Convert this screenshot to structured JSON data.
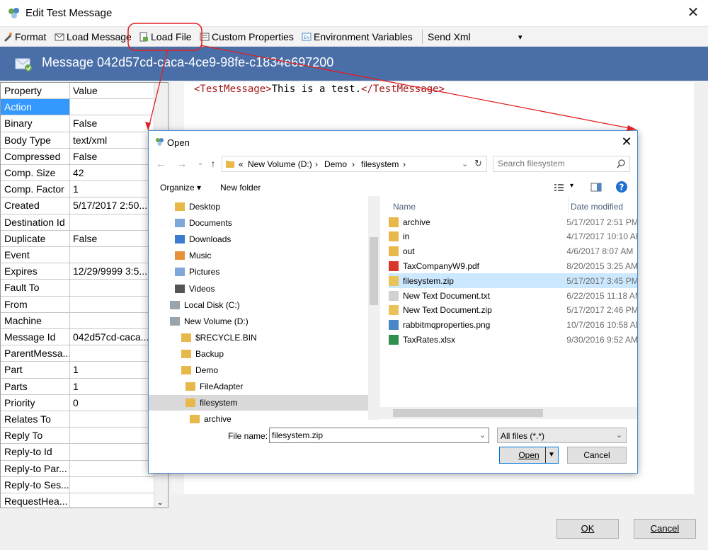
{
  "window": {
    "title": "Edit Test Message",
    "close": "✕"
  },
  "toolbar": {
    "format": "Format",
    "load_message": "Load Message",
    "load_file": "Load File",
    "custom_properties": "Custom Properties",
    "environment_variables": "Environment Variables",
    "send_xml": "Send Xml",
    "dropdown": "▾"
  },
  "header": {
    "title": "Message 042d57cd-caca-4ce9-98fe-c1834e697200"
  },
  "grid": {
    "col_property": "Property",
    "col_value": "Value",
    "rows": [
      {
        "p": "Action",
        "v": ""
      },
      {
        "p": "Binary",
        "v": "False"
      },
      {
        "p": "Body Type",
        "v": "text/xml"
      },
      {
        "p": "Compressed",
        "v": "False"
      },
      {
        "p": "Comp. Size",
        "v": "42"
      },
      {
        "p": "Comp. Factor",
        "v": "1"
      },
      {
        "p": "Created",
        "v": "5/17/2017 2:50..."
      },
      {
        "p": "Destination Id",
        "v": ""
      },
      {
        "p": "Duplicate",
        "v": "False"
      },
      {
        "p": "Event",
        "v": ""
      },
      {
        "p": "Expires",
        "v": "12/29/9999 3:5..."
      },
      {
        "p": "Fault To",
        "v": ""
      },
      {
        "p": "From",
        "v": ""
      },
      {
        "p": "Machine",
        "v": ""
      },
      {
        "p": "Message Id",
        "v": "042d57cd-caca..."
      },
      {
        "p": "ParentMessa...",
        "v": ""
      },
      {
        "p": "Part",
        "v": "1"
      },
      {
        "p": "Parts",
        "v": "1"
      },
      {
        "p": "Priority",
        "v": "0"
      },
      {
        "p": "Relates To",
        "v": ""
      },
      {
        "p": "Reply To",
        "v": ""
      },
      {
        "p": "Reply-to Id",
        "v": ""
      },
      {
        "p": "Reply-to Par...",
        "v": ""
      },
      {
        "p": "Reply-to Ses...",
        "v": ""
      },
      {
        "p": "RequestHea...",
        "v": ""
      }
    ]
  },
  "editor": {
    "open_tag": "<TestMessage>",
    "text": "This is a test.",
    "close_tag": "</TestMessage>"
  },
  "buttons": {
    "ok": "OK",
    "cancel": "Cancel"
  },
  "dialog": {
    "title": "Open",
    "close": "✕",
    "nav_back": "←",
    "nav_forward": "→",
    "nav_recent": "⌄",
    "nav_up": "↑",
    "breadcrumb": {
      "prefix": "«",
      "parts": [
        "New Volume (D:)",
        "Demo",
        "filesystem"
      ],
      "sep": "›"
    },
    "search_placeholder": "Search filesystem",
    "organize": "Organize ▾",
    "new_folder": "New folder",
    "nav_items": [
      {
        "label": "Desktop"
      },
      {
        "label": "Documents"
      },
      {
        "label": "Downloads"
      },
      {
        "label": "Music"
      },
      {
        "label": "Pictures"
      },
      {
        "label": "Videos"
      },
      {
        "label": "Local Disk (C:)"
      },
      {
        "label": "New Volume (D:)"
      },
      {
        "label": "$RECYCLE.BIN"
      },
      {
        "label": "Backup"
      },
      {
        "label": "Demo"
      },
      {
        "label": "FileAdapter"
      },
      {
        "label": "filesystem"
      },
      {
        "label": "archive"
      }
    ],
    "col_name": "Name",
    "col_date": "Date modified",
    "files": [
      {
        "name": "archive",
        "date": "5/17/2017 2:51 PM"
      },
      {
        "name": "in",
        "date": "4/17/2017 10:10 AM"
      },
      {
        "name": "out",
        "date": "4/6/2017 8:07 AM"
      },
      {
        "name": "TaxCompanyW9.pdf",
        "date": "8/20/2015 3:25 AM"
      },
      {
        "name": "filesystem.zip",
        "date": "5/17/2017 3:45 PM"
      },
      {
        "name": "New Text Document.txt",
        "date": "6/22/2015 11:18 AM"
      },
      {
        "name": "New Text Document.zip",
        "date": "5/17/2017 2:46 PM"
      },
      {
        "name": "rabbitmqproperties.png",
        "date": "10/7/2016 10:58 AM"
      },
      {
        "name": "TaxRates.xlsx",
        "date": "9/30/2016 9:52 AM"
      }
    ],
    "file_name_label": "File name:",
    "file_name_value": "filesystem.zip",
    "file_type": "All files (*.*)",
    "open": "Open",
    "cancel": "Cancel"
  },
  "colors": {
    "header_bg": "#4a6fa8",
    "selection": "#3399ff",
    "annotation": "#e02020",
    "file_selected": "#cce8ff"
  }
}
